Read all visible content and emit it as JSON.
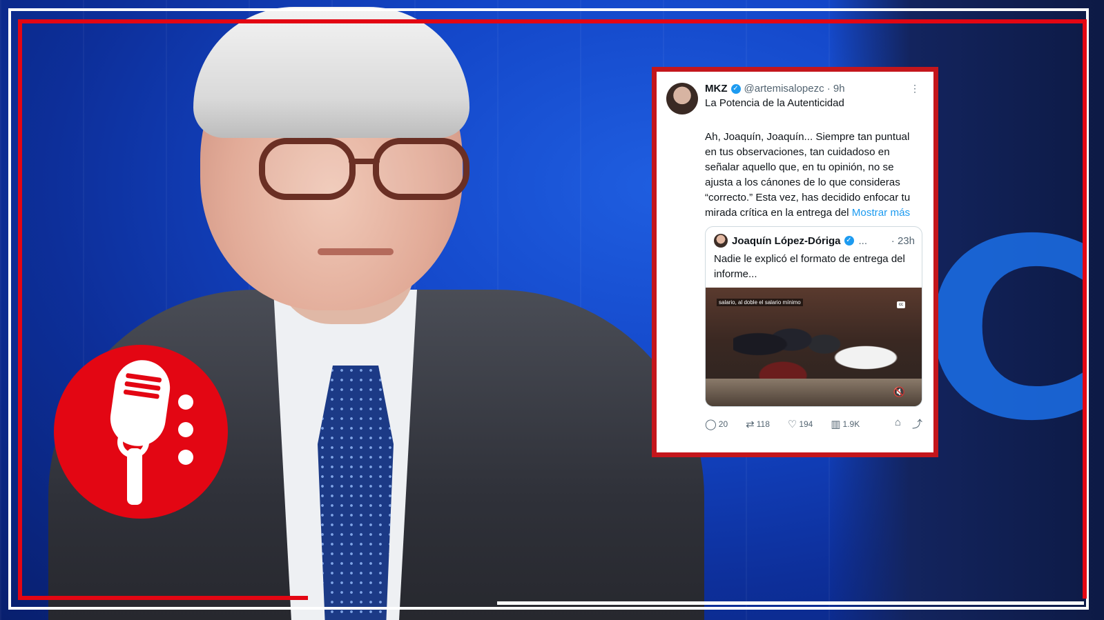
{
  "tweet": {
    "name": "MKZ",
    "handle": "@artemisalopezc · 9h",
    "subtitle": "La Potencia de la Autenticidad",
    "more": "⋮",
    "text": "Ah, Joaquín, Joaquín... Siempre tan puntual en tus observaciones, tan cuidadoso en señalar aquello que, en tu opinión, no se ajusta a los cánones de lo que consideras “correcto.” Esta vez, has decidido enfocar tu mirada crítica en la entrega del ",
    "show_more": "Mostrar más",
    "quote": {
      "name": "Joaquín López-Dóriga",
      "ellipsis": "...",
      "time": "· 23h",
      "text": "Nadie le explicó el formato de entrega del informe...",
      "video_caption": "salario, al doble el salario mínimo"
    },
    "actions": {
      "replies": "20",
      "reposts": "118",
      "likes": "194",
      "views": "1.9K"
    }
  },
  "colors": {
    "accent_red": "#e30613",
    "link_blue": "#1d9bf0"
  },
  "icons": [
    "verified-icon",
    "reply-icon",
    "repost-icon",
    "like-icon",
    "views-icon",
    "bookmark-icon",
    "share-icon",
    "microphone-icon",
    "mute-icon",
    "captions-icon"
  ]
}
